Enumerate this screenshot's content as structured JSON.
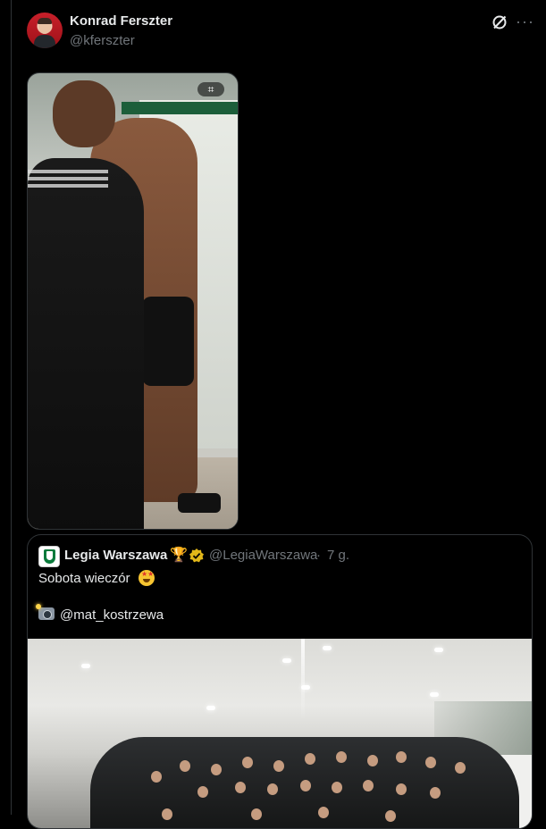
{
  "post": {
    "author": {
      "display_name": "Konrad Ferszter",
      "handle": "@kferszter"
    },
    "actions": {
      "more_label": "···"
    }
  },
  "quote": {
    "author": {
      "display_name": "Legia Warszawa",
      "handle": "@LegiaWarszawa",
      "separator": "·",
      "time": "7 g."
    },
    "text_line1": "Sobota wieczór",
    "mention": "@mat_kostrzewa"
  },
  "colors": {
    "background": "#000000",
    "text": "#e7e9ea",
    "muted": "#71767b",
    "border": "#2f3336",
    "verified": "#e2b719"
  }
}
